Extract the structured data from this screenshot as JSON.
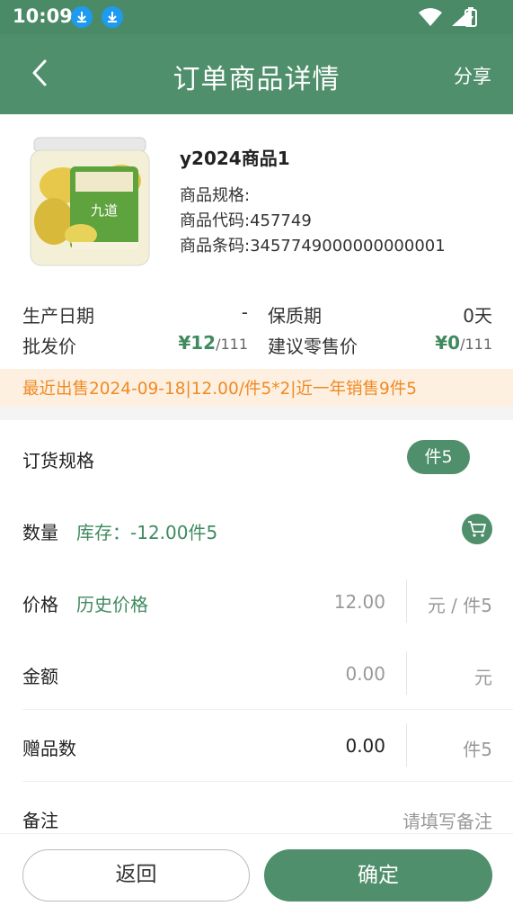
{
  "status_bar": {
    "time": "10:09"
  },
  "header": {
    "title": "订单商品详情",
    "share_label": "分享"
  },
  "product": {
    "name": "y2024商品1",
    "spec_label": "商品规格:",
    "code_label": "商品代码:",
    "code": "457749",
    "barcode_label": "商品条码:",
    "barcode": "3457749000000000001"
  },
  "attributes": {
    "production_date_label": "生产日期",
    "production_date": "-",
    "shelf_life_label": "保质期",
    "shelf_life": "0天",
    "wholesale_label": "批发价",
    "wholesale_price": "¥12",
    "wholesale_unit": "/111",
    "retail_label": "建议零售价",
    "retail_price": "¥0",
    "retail_unit": "/111"
  },
  "notice": "最近出售2024-09-18|12.00/件5*2|近一年销售9件5",
  "order": {
    "spec_label": "订货规格",
    "spec_option": "件5",
    "qty_label": "数量",
    "stock_text": "库存：-12.00件5",
    "price_label": "价格",
    "history_price_link": "历史价格",
    "price_value": "12.00",
    "price_unit": "元 / 件5",
    "amount_label": "金额",
    "amount_value": "0.00",
    "amount_unit": "元",
    "gift_label": "赠品数",
    "gift_value": "0.00",
    "gift_unit": "件5",
    "remark_label": "备注",
    "remark_placeholder": "请填写备注"
  },
  "buttons": {
    "back": "返回",
    "confirm": "确定"
  },
  "colors": {
    "primary": "#4f8f6b",
    "notice_bg": "#fdf0e0",
    "notice_text": "#f08a24"
  }
}
